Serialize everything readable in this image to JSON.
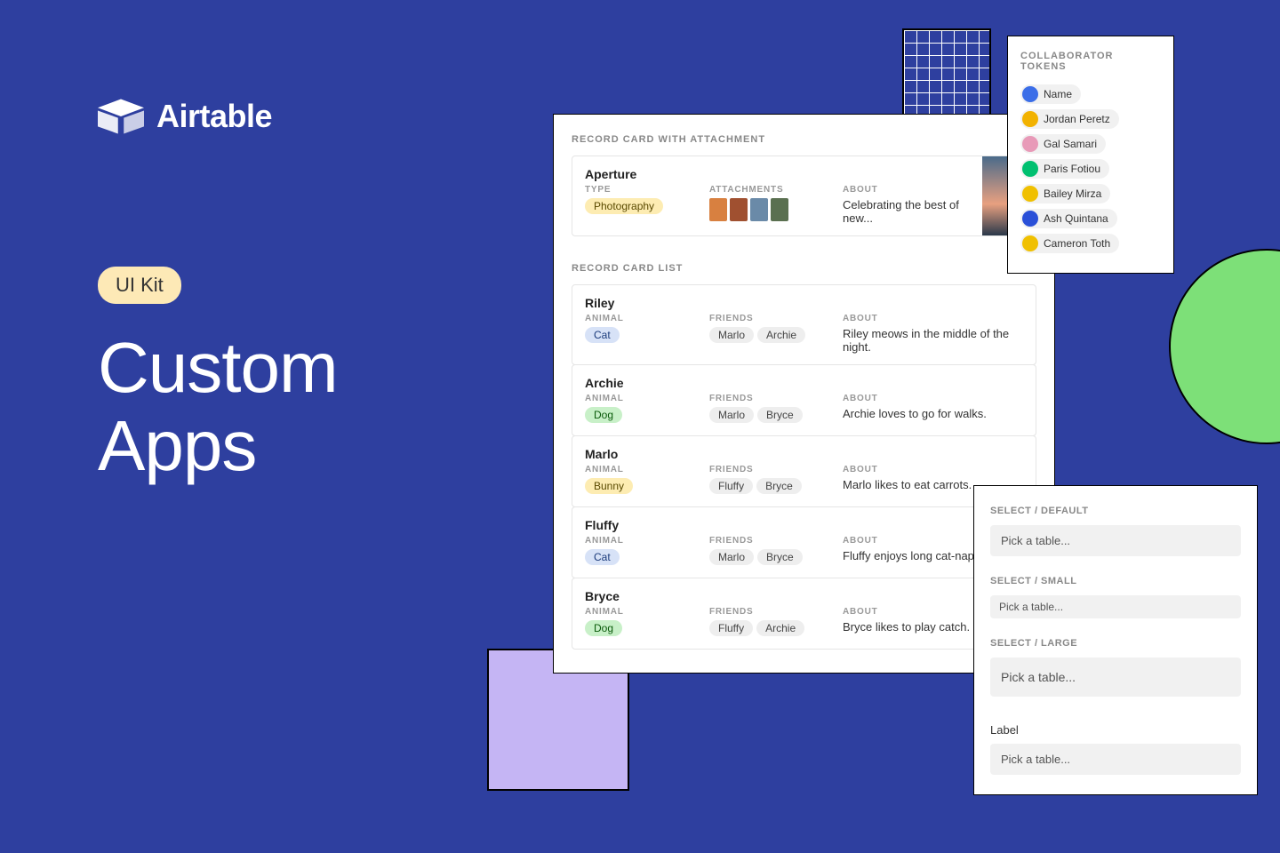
{
  "brand": {
    "name": "Airtable"
  },
  "badge": "UI Kit",
  "headline_line1": "Custom",
  "headline_line2": "Apps",
  "records_panel": {
    "section1_label": "RECORD CARD WITH ATTACHMENT",
    "attachment_card": {
      "title": "Aperture",
      "type_label": "TYPE",
      "type_value": "Photography",
      "attachments_label": "ATTACHMENTS",
      "about_label": "ABOUT",
      "about_value": "Celebrating the best of new..."
    },
    "section2_label": "RECORD CARD LIST",
    "field_animal_label": "ANIMAL",
    "field_friends_label": "FRIENDS",
    "field_about_label": "ABOUT",
    "list": [
      {
        "title": "Riley",
        "animal": "Cat",
        "animal_color": "blue",
        "friends": [
          "Marlo",
          "Archie"
        ],
        "about": "Riley meows in the middle of the night."
      },
      {
        "title": "Archie",
        "animal": "Dog",
        "animal_color": "green",
        "friends": [
          "Marlo",
          "Bryce"
        ],
        "about": "Archie loves to go for walks."
      },
      {
        "title": "Marlo",
        "animal": "Bunny",
        "animal_color": "yellow",
        "friends": [
          "Fluffy",
          "Bryce"
        ],
        "about": "Marlo likes to eat carrots."
      },
      {
        "title": "Fluffy",
        "animal": "Cat",
        "animal_color": "blue",
        "friends": [
          "Marlo",
          "Bryce"
        ],
        "about": "Fluffy enjoys long cat-naps."
      },
      {
        "title": "Bryce",
        "animal": "Dog",
        "animal_color": "green",
        "friends": [
          "Fluffy",
          "Archie"
        ],
        "about": "Bryce likes to play catch."
      }
    ]
  },
  "collab_panel": {
    "label": "COLLABORATOR TOKENS",
    "items": [
      {
        "name": "Name",
        "color": "#3b6ee8"
      },
      {
        "name": "Jordan Peretz",
        "color": "#f2b200"
      },
      {
        "name": "Gal Samari",
        "color": "#e89ab8"
      },
      {
        "name": "Paris Fotiou",
        "color": "#00c070"
      },
      {
        "name": "Bailey Mirza",
        "color": "#f0c000"
      },
      {
        "name": "Ash Quintana",
        "color": "#2a50d8"
      },
      {
        "name": "Cameron Toth",
        "color": "#f0c000"
      }
    ]
  },
  "select_panel": {
    "default_label": "SELECT / DEFAULT",
    "small_label": "SELECT / SMALL",
    "large_label": "SELECT / LARGE",
    "placeholder": "Pick a table...",
    "plain_label": "Label"
  },
  "thumb_colors": [
    "#d88040",
    "#a05030",
    "#6a8aa8",
    "#5a7050"
  ]
}
